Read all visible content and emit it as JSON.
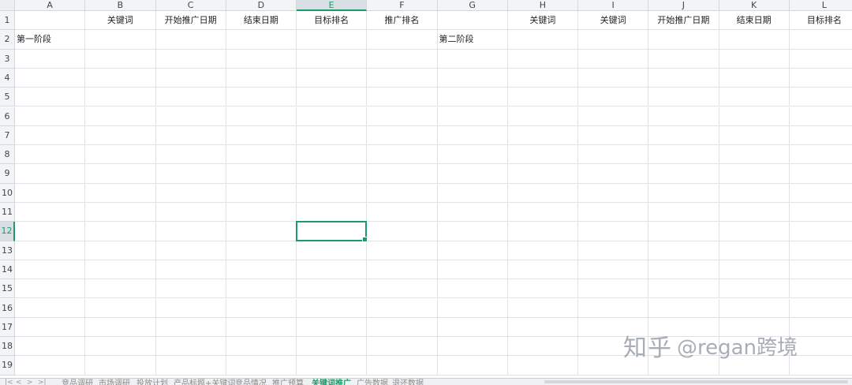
{
  "column_letters": [
    "A",
    "B",
    "C",
    "D",
    "E",
    "F",
    "G",
    "H",
    "I",
    "J",
    "K",
    "L"
  ],
  "row_numbers": [
    "1",
    "2",
    "3",
    "4",
    "5",
    "6",
    "7",
    "8",
    "9",
    "10",
    "11",
    "12",
    "13",
    "14",
    "15",
    "16",
    "17",
    "18",
    "19"
  ],
  "active_cell": {
    "column": "E",
    "row": "12"
  },
  "cells": [
    {
      "ref": "B1",
      "value": "关键词"
    },
    {
      "ref": "C1",
      "value": "开始推广日期"
    },
    {
      "ref": "D1",
      "value": "结束日期"
    },
    {
      "ref": "E1",
      "value": "目标排名"
    },
    {
      "ref": "F1",
      "value": "推广排名"
    },
    {
      "ref": "H1",
      "value": "关键词"
    },
    {
      "ref": "I1",
      "value": "关键词"
    },
    {
      "ref": "J1",
      "value": "开始推广日期"
    },
    {
      "ref": "K1",
      "value": "结束日期"
    },
    {
      "ref": "L1",
      "value": "目标排名"
    },
    {
      "ref": "A2",
      "value": "第一阶段"
    },
    {
      "ref": "G2",
      "value": "第二阶段"
    }
  ],
  "sheet_tabs": [
    {
      "label": "竞品调研",
      "active": false
    },
    {
      "label": "市场调研",
      "active": false
    },
    {
      "label": "投放计划",
      "active": false
    },
    {
      "label": "产品标题+关键词",
      "active": false
    },
    {
      "label": "竞品情况",
      "active": false
    },
    {
      "label": "推广预算",
      "active": false
    },
    {
      "label": "关键词推广",
      "active": true
    },
    {
      "label": "广告数据",
      "active": false
    },
    {
      "label": "退还数据",
      "active": false
    }
  ],
  "tab_nav_icons": [
    "first-sheet-icon",
    "prev-sheet-icon",
    "next-sheet-icon",
    "last-sheet-icon"
  ],
  "watermark": {
    "part1": "知乎",
    "part2": "@regan跨境"
  },
  "colors": {
    "accent": "#1a9c6a",
    "grid": "#dfe3e8",
    "header_bg": "#f3f4f6"
  }
}
